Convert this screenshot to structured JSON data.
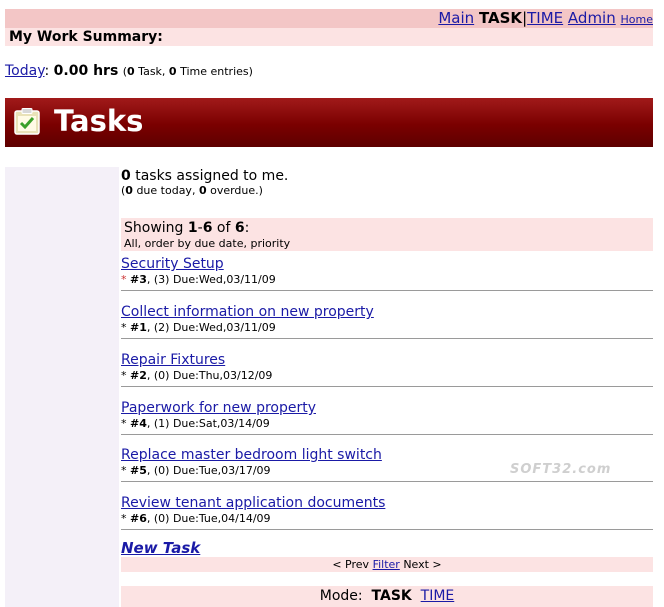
{
  "nav": {
    "main": "Main",
    "task": "TASK",
    "separator": "|",
    "time": "TIME",
    "admin": "Admin",
    "home": "Home"
  },
  "summary": {
    "heading": "My Work Summary:"
  },
  "today": {
    "link": "Today",
    "colon": ":",
    "hours": "0.00 hrs",
    "open": "(",
    "task_count": "0",
    "task_label": " Task, ",
    "time_count": "0",
    "time_label": " Time entries)"
  },
  "banner": {
    "title": "Tasks",
    "icon": "clipboard-check-icon"
  },
  "assigned": {
    "count": "0",
    "text": " tasks assigned to me.",
    "open": "(",
    "due_today": "0",
    "due_today_label": " due today, ",
    "overdue": "0",
    "overdue_label": " overdue.)"
  },
  "showing": {
    "prefix": "Showing ",
    "range": "1",
    "dash": "-",
    "range_end": "6",
    "of": " of ",
    "total": "6",
    "suffix": ":",
    "order": "All, order by due date, priority"
  },
  "tasks": [
    {
      "name": "Security Setup",
      "star": "*",
      "id": "#3",
      "rest": ", (3) Due:Wed,03/11/09"
    },
    {
      "name": "Collect information on new property",
      "star": "*",
      "id": "#1",
      "rest": ", (2) Due:Wed,03/11/09"
    },
    {
      "name": "Repair Fixtures",
      "star": "*",
      "id": "#2",
      "rest": ", (0) Due:Thu,03/12/09"
    },
    {
      "name": "Paperwork for new property",
      "star": "*",
      "id": "#4",
      "rest": ", (1) Due:Sat,03/14/09"
    },
    {
      "name": "Replace master bedroom light switch",
      "star": "*",
      "id": "#5",
      "rest": ", (0) Due:Tue,03/17/09"
    },
    {
      "name": "Review tenant application documents",
      "star": "*",
      "id": "#6",
      "rest": ", (0) Due:Tue,04/14/09"
    }
  ],
  "new_task": "New Task",
  "pager": {
    "prev": "< Prev",
    "filter": "Filter",
    "next": "Next >"
  },
  "mode": {
    "label": "Mode:",
    "task": "TASK",
    "time": "TIME"
  },
  "watermark": "SOFT32.com",
  "colors": {
    "banner": "#7a0000",
    "pink_bar": "#f3c6c6",
    "light_pink": "#fce3e3",
    "link": "#1a1aa6"
  }
}
